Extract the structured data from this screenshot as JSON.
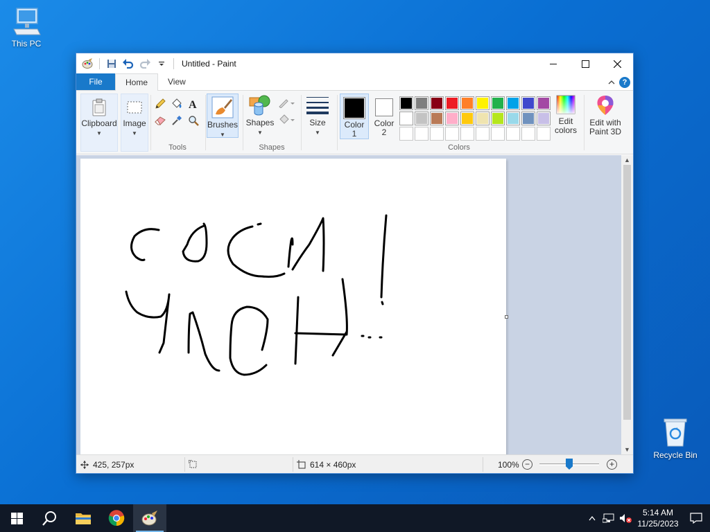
{
  "desktop": {
    "icons": [
      {
        "label": "This PC"
      },
      {
        "label": "Recycle Bin"
      }
    ]
  },
  "window": {
    "title": "Untitled - Paint",
    "tabs": [
      {
        "label": "File"
      },
      {
        "label": "Home"
      },
      {
        "label": "View"
      }
    ],
    "ribbon": {
      "clipboard": {
        "label": "Clipboard"
      },
      "image": {
        "label": "Image"
      },
      "tools_group": "Tools",
      "brushes": {
        "label": "Brushes"
      },
      "shapes": {
        "label": "Shapes"
      },
      "shapes_group": "Shapes",
      "size": {
        "label": "Size"
      },
      "color1": {
        "line1": "Color",
        "line2": "1",
        "value": "#000000"
      },
      "color2": {
        "line1": "Color",
        "line2": "2",
        "value": "#ffffff"
      },
      "colors_group": "Colors",
      "edit_colors": {
        "line1": "Edit",
        "line2": "colors"
      },
      "paint3d": {
        "line1": "Edit with",
        "line2": "Paint 3D"
      },
      "palette_row1": [
        "#000000",
        "#7f7f7f",
        "#880015",
        "#ed1c24",
        "#ff7f27",
        "#fff200",
        "#22b14c",
        "#00a2e8",
        "#3f48cc",
        "#a349a4"
      ],
      "palette_row2": [
        "#ffffff",
        "#c3c3c3",
        "#b97a57",
        "#ffaec9",
        "#ffc90e",
        "#efe4b0",
        "#b5e61d",
        "#99d9ea",
        "#7092be",
        "#c8bfe7"
      ],
      "palette_row3": [
        "#ffffff",
        "#ffffff",
        "#ffffff",
        "#ffffff",
        "#ffffff",
        "#ffffff",
        "#ffffff",
        "#ffffff",
        "#ffffff",
        "#ffffff"
      ]
    },
    "status": {
      "cursor_pos": "425, 257px",
      "image_size": "614 × 460px",
      "zoom": "100%",
      "zoom_fraction": 0.5
    }
  },
  "taskbar": {
    "time": "5:14 AM",
    "date": "11/25/2023"
  },
  "accent": "#1979ca"
}
